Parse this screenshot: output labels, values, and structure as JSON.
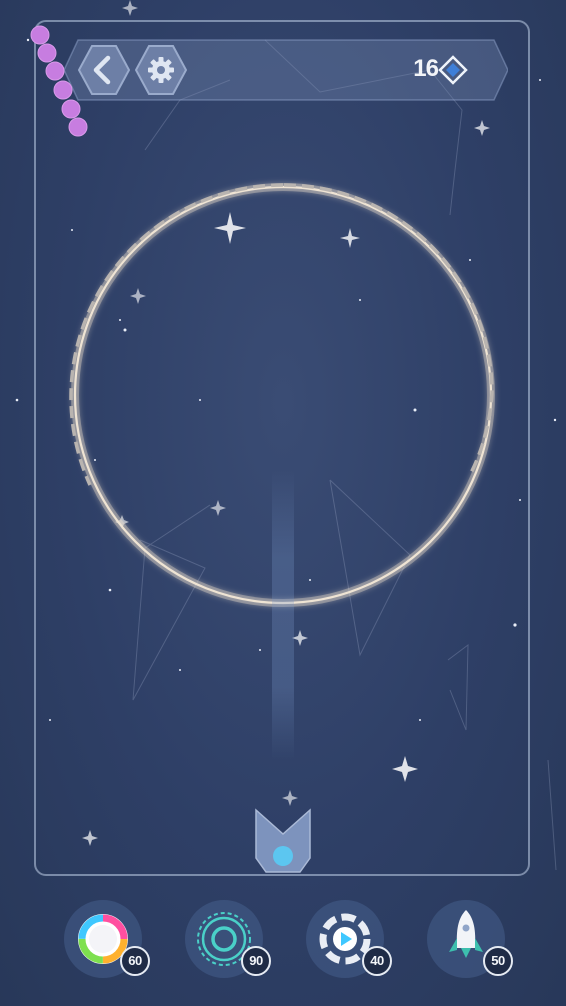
{
  "header": {
    "back_icon": "chevron-left-icon",
    "settings_icon": "gear-icon",
    "gem_count": "16",
    "gem_icon": "diamond-icon"
  },
  "colors": {
    "background": "#2e3f66",
    "snake_ball": "#c77de0",
    "shooter_ball": "#5cc6f0",
    "ring": "#e8dfd2"
  },
  "game": {
    "snake_balls": 6,
    "shooter_ball_color": "#5cc6f0"
  },
  "powerups": [
    {
      "name": "color-wheel",
      "icon": "color-wheel-icon",
      "cost": "60"
    },
    {
      "name": "shield-ring",
      "icon": "target-ring-icon",
      "cost": "90"
    },
    {
      "name": "slow-motion",
      "icon": "play-dial-icon",
      "cost": "40"
    },
    {
      "name": "rocket",
      "icon": "rocket-icon",
      "cost": "50"
    }
  ]
}
